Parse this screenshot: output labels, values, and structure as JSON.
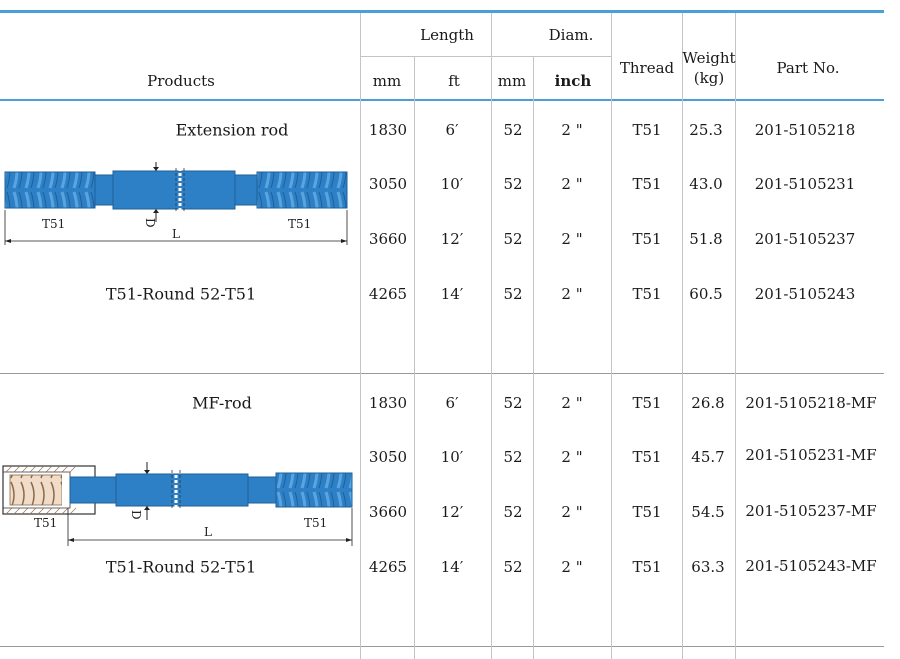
{
  "header": {
    "products": "Products",
    "length": "Length",
    "diam": "Diam.",
    "thread": "Thread",
    "weight_1": "Weight",
    "weight_2": "(kg)",
    "part_no": "Part No.",
    "mm_1": "mm",
    "ft": "ft",
    "mm_2": "mm",
    "inch": "inch"
  },
  "sections": [
    {
      "name": "Extension rod",
      "subtitle": "T51-Round 52-T51",
      "diagram": {
        "left_thread": "T51",
        "right_thread": "T51",
        "dim_l": "L",
        "dim_d": "D"
      },
      "rows": [
        {
          "mm": "1830",
          "ft": "6′",
          "dmm": "52",
          "inch": "2 \"",
          "thread": "T51",
          "weight": "25.3",
          "part": "201-5105218"
        },
        {
          "mm": "3050",
          "ft": "10′",
          "dmm": "52",
          "inch": "2 \"",
          "thread": "T51",
          "weight": "43.0",
          "part": "201-5105231"
        },
        {
          "mm": "3660",
          "ft": "12′",
          "dmm": "52",
          "inch": "2 \"",
          "thread": "T51",
          "weight": "51.8",
          "part": "201-5105237"
        },
        {
          "mm": "4265",
          "ft": "14′",
          "dmm": "52",
          "inch": "2 \"",
          "thread": "T51",
          "weight": "60.5",
          "part": "201-5105243"
        }
      ]
    },
    {
      "name": "MF-rod",
      "subtitle": "T51-Round 52-T51",
      "diagram": {
        "left_thread": "T51",
        "right_thread": "T51",
        "dim_l": "L",
        "dim_d": "D"
      },
      "rows": [
        {
          "mm": "1830",
          "ft": "6′",
          "dmm": "52",
          "inch": "2 \"",
          "thread": "T51",
          "weight": "26.8",
          "part": "201-5105218-MF"
        },
        {
          "mm": "3050",
          "ft": "10′",
          "dmm": "52",
          "inch": "2 \"",
          "thread": "T51",
          "weight": "45.7",
          "part": "201-5105231-MF"
        },
        {
          "mm": "3660",
          "ft": "12′",
          "dmm": "52",
          "inch": "2 \"",
          "thread": "T51",
          "weight": "54.5",
          "part": "201-5105237-MF"
        },
        {
          "mm": "4265",
          "ft": "14′",
          "dmm": "52",
          "inch": "2 \"",
          "thread": "T51",
          "weight": "63.3",
          "part": "201-5105243-MF"
        }
      ]
    }
  ],
  "colors": {
    "rule": "#4aa0d6",
    "rod": "#2e80c6",
    "rod_dark": "#1d5f99",
    "thread_groove": "#5aa4e0"
  }
}
